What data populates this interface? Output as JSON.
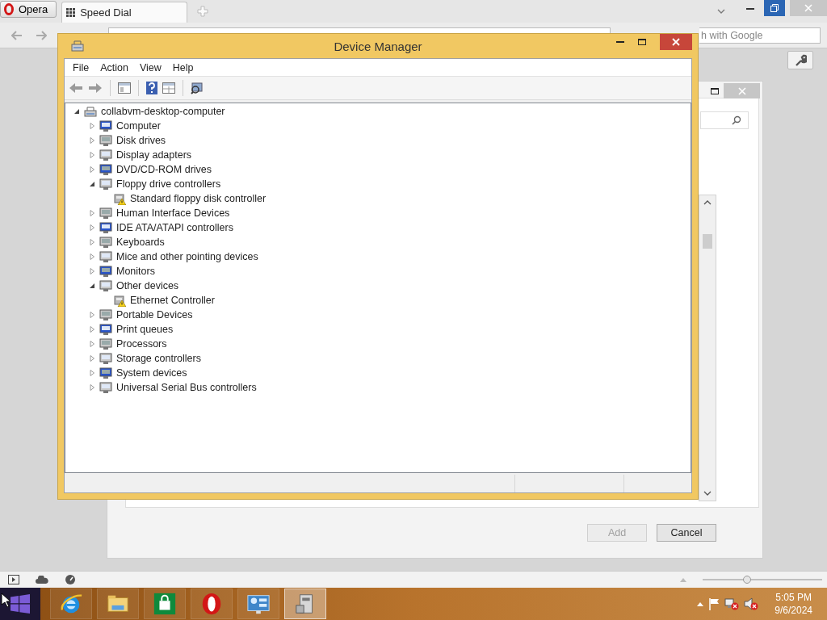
{
  "browser": {
    "menu_button": "Opera",
    "tabs": [
      {
        "label": "Speed Dial",
        "selected": true
      }
    ],
    "search": {
      "placeholder": "h with Google"
    },
    "zoom": {
      "level": 0.36
    },
    "dialog": {
      "buttons": [
        {
          "label": "Add",
          "disabled": true
        },
        {
          "label": "Cancel",
          "disabled": false
        }
      ]
    }
  },
  "device_manager": {
    "title": "Device Manager",
    "menu": [
      "File",
      "Action",
      "View",
      "Help"
    ],
    "tree": {
      "label": "collabvm-desktop-computer",
      "expanded": true,
      "children": [
        {
          "label": "Computer",
          "expanded": false
        },
        {
          "label": "Disk drives",
          "expanded": false
        },
        {
          "label": "Display adapters",
          "expanded": false
        },
        {
          "label": "DVD/CD-ROM drives",
          "expanded": false
        },
        {
          "label": "Floppy drive controllers",
          "expanded": true,
          "children": [
            {
              "label": "Standard floppy disk controller",
              "warning": true
            }
          ]
        },
        {
          "label": "Human Interface Devices",
          "expanded": false
        },
        {
          "label": "IDE ATA/ATAPI controllers",
          "expanded": false
        },
        {
          "label": "Keyboards",
          "expanded": false
        },
        {
          "label": "Mice and other pointing devices",
          "expanded": false
        },
        {
          "label": "Monitors",
          "expanded": false
        },
        {
          "label": "Other devices",
          "expanded": true,
          "children": [
            {
              "label": "Ethernet Controller",
              "warning": true
            }
          ]
        },
        {
          "label": "Portable Devices",
          "expanded": false
        },
        {
          "label": "Print queues",
          "expanded": false
        },
        {
          "label": "Processors",
          "expanded": false
        },
        {
          "label": "Storage controllers",
          "expanded": false
        },
        {
          "label": "System devices",
          "expanded": false
        },
        {
          "label": "Universal Serial Bus controllers",
          "expanded": false
        }
      ]
    }
  },
  "taskbar": {
    "apps": [
      {
        "kind": "ie",
        "selected": false
      },
      {
        "kind": "explorer",
        "selected": false
      },
      {
        "kind": "store",
        "selected": false
      },
      {
        "kind": "opera",
        "selected": false
      },
      {
        "kind": "control",
        "selected": false
      },
      {
        "kind": "devmgr",
        "selected": true
      }
    ],
    "clock": {
      "time": "5:05 PM",
      "date": "9/6/2024"
    }
  }
}
